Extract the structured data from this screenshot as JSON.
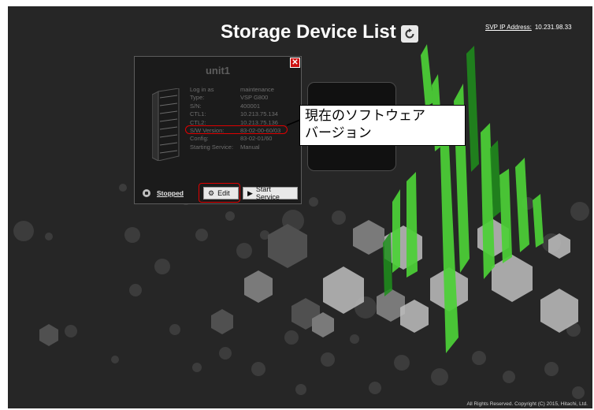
{
  "header": {
    "title": "Storage Device List",
    "refresh_icon": "refresh-icon",
    "svp_label": "SVP IP Address:",
    "svp_value": "10.231.98.33"
  },
  "panel": {
    "unit_name": "unit1",
    "close_icon": "close-icon",
    "device_icon": "storage-rack-icon",
    "fields": [
      {
        "key": "Log in as",
        "value": "maintenance"
      },
      {
        "key": "Type:",
        "value": "VSP G800"
      },
      {
        "key": "S/N:",
        "value": "400001"
      },
      {
        "key": "CTL1:",
        "value": "10.213.75.134"
      },
      {
        "key": "CTL2:",
        "value": "10.213.75.136"
      },
      {
        "key": "S/W Version:",
        "value": "83-02-00-60/03"
      },
      {
        "key": "Config:",
        "value": "83-02-01/60"
      },
      {
        "key": "Starting Service:",
        "value": "Manual"
      }
    ],
    "status_label": "Stopped",
    "edit_label": "Edit",
    "start_label": "Start Service"
  },
  "callout": {
    "line1": "現在のソフトウェア",
    "line2": "バージョン"
  },
  "footer": {
    "copyright": "All Rights Reserved. Copyright (C) 2015, Hitachi, Ltd."
  },
  "colors": {
    "background": "#262626",
    "accent_green": "#4cd137",
    "highlight_red": "#e00000"
  }
}
